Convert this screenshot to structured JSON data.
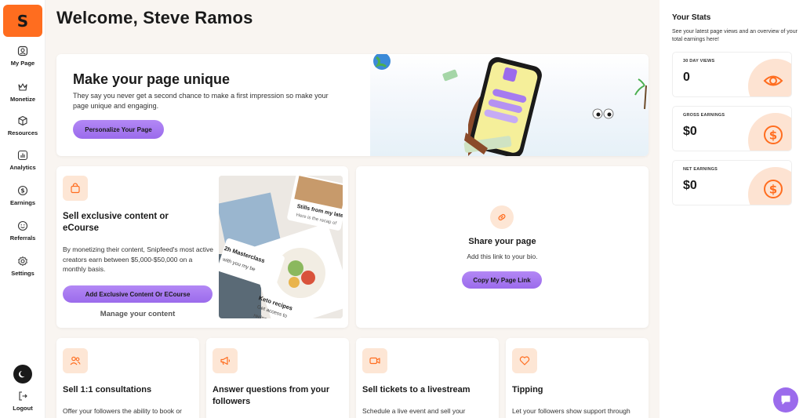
{
  "app": {
    "logo_letter": "S"
  },
  "sidebar": {
    "items": [
      {
        "label": "My Page",
        "icon": "user-square-icon"
      },
      {
        "label": "Monetize",
        "icon": "crown-icon"
      },
      {
        "label": "Resources",
        "icon": "box-icon"
      },
      {
        "label": "Analytics",
        "icon": "chart-icon"
      },
      {
        "label": "Earnings",
        "icon": "dollar-circle-icon"
      },
      {
        "label": "Referrals",
        "icon": "smile-icon"
      },
      {
        "label": "Settings",
        "icon": "gear-icon"
      }
    ],
    "logout": "Logout"
  },
  "header": {
    "title": "Welcome, Steve Ramos"
  },
  "hero": {
    "title": "Make your page unique",
    "description": "They say you never get a second chance to make a first impression so make your page unique and engaging.",
    "button": "Personalize Your Page"
  },
  "sell": {
    "title": "Sell exclusive content or eCourse",
    "description": "By monetizing their content, Snipfeed's most active creators earn between $5,000-$50,000 on a monthly basis.",
    "button": "Add Exclusive Content Or ECourse",
    "link": "Manage your content",
    "collage_texts": [
      "Stills from my late",
      "Here is the recap of",
      "2h Masterclass",
      "with you my be",
      "Keto recipes",
      "Get access to",
      "recipes"
    ]
  },
  "share": {
    "title": "Share your page",
    "subtitle": "Add this link to your bio.",
    "button": "Copy My Page Link"
  },
  "feature_cards": [
    {
      "title": "Sell 1:1 consultations",
      "description": "Offer your followers the ability to book or",
      "icon": "people-icon"
    },
    {
      "title": "Answer questions from your followers",
      "description": "",
      "icon": "megaphone-icon"
    },
    {
      "title": "Sell tickets to a livestream",
      "description": "Schedule a live event and sell your",
      "icon": "video-icon"
    },
    {
      "title": "Tipping",
      "description": "Let your followers show support through",
      "icon": "heart-icon"
    }
  ],
  "stats": {
    "title": "Your Stats",
    "description": "See your latest page views and an overview of your total earnings here!",
    "items": [
      {
        "label": "30 DAY VIEWS",
        "value": "0",
        "icon": "eye-icon"
      },
      {
        "label": "GROSS EARNINGS",
        "value": "$0",
        "icon": "dollar-circle-icon"
      },
      {
        "label": "NET EARNINGS",
        "value": "$0",
        "icon": "dollar-circle-icon"
      }
    ]
  },
  "colors": {
    "accent": "#ff6d1f",
    "purple": "#9b6bec",
    "tile": "#fde6d5"
  }
}
